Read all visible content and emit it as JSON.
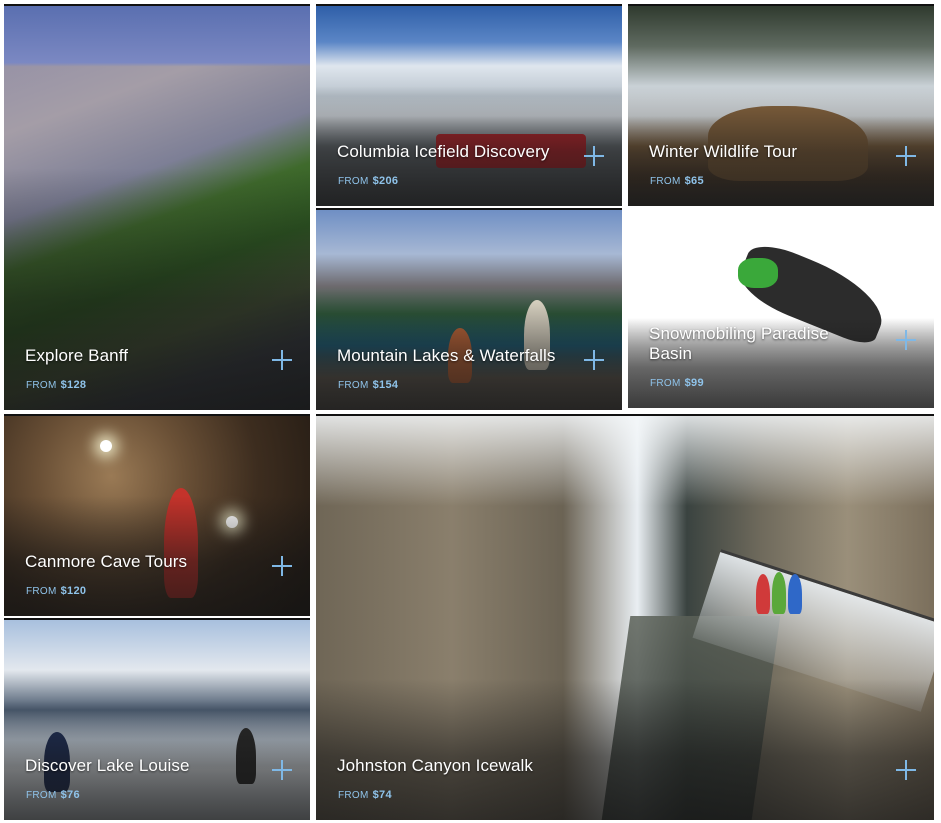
{
  "tours": [
    {
      "id": "banff",
      "title": "Explore Banff",
      "from_label": "FROM",
      "price": "$128"
    },
    {
      "id": "icefield",
      "title": "Columbia Icefield Discovery",
      "from_label": "FROM",
      "price": "$206"
    },
    {
      "id": "wildlife",
      "title": "Winter Wildlife Tour",
      "from_label": "FROM",
      "price": "$65"
    },
    {
      "id": "lakes",
      "title": "Mountain Lakes & Waterfalls",
      "from_label": "FROM",
      "price": "$154"
    },
    {
      "id": "snowmobile",
      "title_line1": "Snowmobiling Paradise",
      "title_line2": "Basin",
      "from_label": "FROM",
      "price": "$99"
    },
    {
      "id": "cave",
      "title": "Canmore Cave Tours",
      "from_label": "FROM",
      "price": "$120"
    },
    {
      "id": "louise",
      "title": "Discover Lake Louise",
      "from_label": "FROM",
      "price": "$76"
    },
    {
      "id": "canyon",
      "title": "Johnston Canyon Icewalk",
      "from_label": "FROM",
      "price": "$74"
    }
  ],
  "icons": {
    "expand": "plus-icon"
  },
  "colors": {
    "accent": "#7fb8e6",
    "price_text": "#8fc3ea",
    "title_text": "#ffffff"
  }
}
